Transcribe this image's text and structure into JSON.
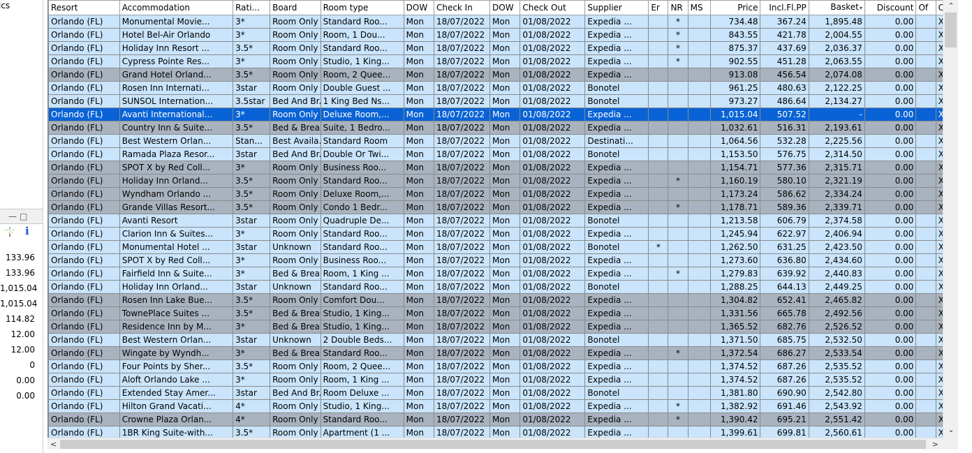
{
  "left_panel": {
    "top_text": "ics",
    "info_symbol": "i",
    "values": [
      "133.96",
      "133.96",
      "1,015.04",
      "1,015.04",
      "114.82",
      "12.00",
      "12.00",
      "0",
      "0.00",
      "0.00"
    ]
  },
  "grid": {
    "columns": [
      "Resort",
      "Accommodation",
      "Rati...",
      "Board",
      "Room type",
      "DOW",
      "Check In",
      "DOW",
      "Check Out",
      "Supplier",
      "Er",
      "NR",
      "MS",
      "Price",
      "Incl.Fl.PP",
      "Basket",
      "Discount",
      "Of",
      "Con"
    ],
    "rows": [
      [
        "Orlando (FL)",
        "Monumental Movie...",
        "3*",
        "Room Only",
        "Standard Roo...",
        "Mon",
        "18/07/2022",
        "Mon",
        "01/08/2022",
        "Expedia ...",
        "",
        "*",
        "",
        "734.48",
        "367.24",
        "1,895.48",
        "0.00",
        "",
        "XMI"
      ],
      [
        "Orlando (FL)",
        "Hotel Bel-Air Orlando",
        "3*",
        "Room Only",
        "Room, 1 Dou...",
        "Mon",
        "18/07/2022",
        "Mon",
        "01/08/2022",
        "Expedia ...",
        "",
        "*",
        "",
        "843.55",
        "421.78",
        "2,004.55",
        "0.00",
        "",
        "XMI"
      ],
      [
        "Orlando (FL)",
        "Holiday Inn Resort ...",
        "3.5*",
        "Room Only",
        "Standard Roo...",
        "Mon",
        "18/07/2022",
        "Mon",
        "01/08/2022",
        "Expedia ...",
        "",
        "*",
        "",
        "875.37",
        "437.69",
        "2,036.37",
        "0.00",
        "",
        "XMI"
      ],
      [
        "Orlando (FL)",
        "Cypress Pointe Res...",
        "3*",
        "Room Only",
        "Studio, 1 King...",
        "Mon",
        "18/07/2022",
        "Mon",
        "01/08/2022",
        "Expedia ...",
        "",
        "*",
        "",
        "902.55",
        "451.28",
        "2,063.55",
        "0.00",
        "",
        "XMI"
      ],
      [
        "Orlando (FL)",
        "Grand Hotel Orland...",
        "3.5*",
        "Room Only",
        "Room, 2 Quee...",
        "Mon",
        "18/07/2022",
        "Mon",
        "01/08/2022",
        "Expedia ...",
        "",
        "",
        "",
        "913.08",
        "456.54",
        "2,074.08",
        "0.00",
        "",
        "XMI"
      ],
      [
        "Orlando (FL)",
        "Rosen Inn Internati...",
        "3star",
        "Room Only",
        "Double Guest ...",
        "Mon",
        "18/07/2022",
        "Mon",
        "01/08/2022",
        "Bonotel",
        "",
        "",
        "",
        "961.25",
        "480.63",
        "2,122.25",
        "0.00",
        "",
        "XMI"
      ],
      [
        "Orlando (FL)",
        "SUNSOL Internation...",
        "3.5star",
        "Bed And Br...",
        "1 King Bed Ns...",
        "Mon",
        "18/07/2022",
        "Mon",
        "01/08/2022",
        "Bonotel",
        "",
        "",
        "",
        "973.27",
        "486.64",
        "2,134.27",
        "0.00",
        "",
        "XMI"
      ],
      [
        "Orlando (FL)",
        "Avanti International...",
        "3*",
        "Room Only",
        "Deluxe Room,...",
        "Mon",
        "18/07/2022",
        "Mon",
        "01/08/2022",
        "Expedia ...",
        "",
        "",
        "",
        "1,015.04",
        "507.52",
        "-",
        "0.00",
        "",
        "XMI"
      ],
      [
        "Orlando (FL)",
        "Country Inn & Suite...",
        "3.5*",
        "Bed & Brea...",
        "Suite, 1 Bedro...",
        "Mon",
        "18/07/2022",
        "Mon",
        "01/08/2022",
        "Expedia ...",
        "",
        "",
        "",
        "1,032.61",
        "516.31",
        "2,193.61",
        "0.00",
        "",
        "XMI"
      ],
      [
        "Orlando (FL)",
        "Best Western Orlan...",
        "Stan...",
        "Best Availa...",
        "Standard Room",
        "Mon",
        "18/07/2022",
        "Mon",
        "01/08/2022",
        "Destinati...",
        "",
        "",
        "",
        "1,064.56",
        "532.28",
        "2,225.56",
        "0.00",
        "",
        "XMI"
      ],
      [
        "Orlando (FL)",
        "Ramada Plaza Resor...",
        "3star",
        "Bed And Br...",
        "Double Or Twi...",
        "Mon",
        "18/07/2022",
        "Mon",
        "01/08/2022",
        "Bonotel",
        "",
        "",
        "",
        "1,153.50",
        "576.75",
        "2,314.50",
        "0.00",
        "",
        "XMI"
      ],
      [
        "Orlando (FL)",
        "SPOT X by Red Coll...",
        "3*",
        "Room Only",
        "Business Roo...",
        "Mon",
        "18/07/2022",
        "Mon",
        "01/08/2022",
        "Expedia ...",
        "",
        "",
        "",
        "1,154.71",
        "577.36",
        "2,315.71",
        "0.00",
        "",
        "XMI"
      ],
      [
        "Orlando (FL)",
        "Holiday Inn Orland...",
        "3.5*",
        "Room Only",
        "Standard Roo...",
        "Mon",
        "18/07/2022",
        "Mon",
        "01/08/2022",
        "Expedia ...",
        "",
        "*",
        "",
        "1,160.19",
        "580.10",
        "2,321.19",
        "0.00",
        "",
        "XMI"
      ],
      [
        "Orlando (FL)",
        "Wyndham Orlando ...",
        "3.5*",
        "Room Only",
        "Deluxe Room,...",
        "Mon",
        "18/07/2022",
        "Mon",
        "01/08/2022",
        "Expedia ...",
        "",
        "",
        "",
        "1,173.24",
        "586.62",
        "2,334.24",
        "0.00",
        "",
        "XMI"
      ],
      [
        "Orlando (FL)",
        "Grande Villas Resort...",
        "3.5*",
        "Room Only",
        "Condo 1 Bedr...",
        "Mon",
        "18/07/2022",
        "Mon",
        "01/08/2022",
        "Expedia ...",
        "",
        "*",
        "",
        "1,178.71",
        "589.36",
        "2,339.71",
        "0.00",
        "",
        "XMI"
      ],
      [
        "Orlando (FL)",
        "Avanti Resort",
        "3star",
        "Room Only",
        "Quadruple De...",
        "Mon",
        "18/07/2022",
        "Mon",
        "01/08/2022",
        "Bonotel",
        "",
        "",
        "",
        "1,213.58",
        "606.79",
        "2,374.58",
        "0.00",
        "",
        "XMI"
      ],
      [
        "Orlando (FL)",
        "Clarion Inn & Suites...",
        "3*",
        "Room Only",
        "Standard Roo...",
        "Mon",
        "18/07/2022",
        "Mon",
        "01/08/2022",
        "Expedia ...",
        "",
        "",
        "",
        "1,245.94",
        "622.97",
        "2,406.94",
        "0.00",
        "",
        "XMI"
      ],
      [
        "Orlando (FL)",
        "Monumental Hotel ...",
        "3star",
        "Unknown",
        "Standard Roo...",
        "Mon",
        "18/07/2022",
        "Mon",
        "01/08/2022",
        "Bonotel",
        "*",
        "",
        "",
        "1,262.50",
        "631.25",
        "2,423.50",
        "0.00",
        "",
        "XMI"
      ],
      [
        "Orlando (FL)",
        "SPOT X by Red Coll...",
        "3*",
        "Room Only",
        "Business Roo...",
        "Mon",
        "18/07/2022",
        "Mon",
        "01/08/2022",
        "Expedia ...",
        "",
        "",
        "",
        "1,273.60",
        "636.80",
        "2,434.60",
        "0.00",
        "",
        "XMI"
      ],
      [
        "Orlando (FL)",
        "Fairfield Inn & Suite...",
        "3*",
        "Bed & Brea...",
        "Room, 1 King ...",
        "Mon",
        "18/07/2022",
        "Mon",
        "01/08/2022",
        "Expedia ...",
        "",
        "*",
        "",
        "1,279.83",
        "639.92",
        "2,440.83",
        "0.00",
        "",
        "XMI"
      ],
      [
        "Orlando (FL)",
        "Holiday Inn Orland...",
        "3star",
        "Unknown",
        "Standard Roo...",
        "Mon",
        "18/07/2022",
        "Mon",
        "01/08/2022",
        "Bonotel",
        "",
        "",
        "",
        "1,288.25",
        "644.13",
        "2,449.25",
        "0.00",
        "",
        "XMI"
      ],
      [
        "Orlando (FL)",
        "Rosen Inn Lake Bue...",
        "3.5*",
        "Room Only",
        "Comfort Dou...",
        "Mon",
        "18/07/2022",
        "Mon",
        "01/08/2022",
        "Expedia ...",
        "",
        "",
        "",
        "1,304.82",
        "652.41",
        "2,465.82",
        "0.00",
        "",
        "XMI"
      ],
      [
        "Orlando (FL)",
        "TownePlace Suites ...",
        "3.5*",
        "Bed & Brea...",
        "Studio, 1 King...",
        "Mon",
        "18/07/2022",
        "Mon",
        "01/08/2022",
        "Expedia ...",
        "",
        "",
        "",
        "1,331.56",
        "665.78",
        "2,492.56",
        "0.00",
        "",
        "XMI"
      ],
      [
        "Orlando (FL)",
        "Residence Inn by M...",
        "3*",
        "Bed & Brea...",
        "Studio, 1 King...",
        "Mon",
        "18/07/2022",
        "Mon",
        "01/08/2022",
        "Expedia ...",
        "",
        "",
        "",
        "1,365.52",
        "682.76",
        "2,526.52",
        "0.00",
        "",
        "XMI"
      ],
      [
        "Orlando (FL)",
        "Best Western Orlan...",
        "3star",
        "Unknown",
        "2 Double Beds...",
        "Mon",
        "18/07/2022",
        "Mon",
        "01/08/2022",
        "Bonotel",
        "",
        "",
        "",
        "1,371.50",
        "685.75",
        "2,532.50",
        "0.00",
        "",
        "XMI"
      ],
      [
        "Orlando (FL)",
        "Wingate by Wyndh...",
        "3*",
        "Bed & Brea...",
        "Standard Roo...",
        "Mon",
        "18/07/2022",
        "Mon",
        "01/08/2022",
        "Expedia ...",
        "",
        "*",
        "",
        "1,372.54",
        "686.27",
        "2,533.54",
        "0.00",
        "",
        "XMI"
      ],
      [
        "Orlando (FL)",
        "Four Points by Sher...",
        "3.5*",
        "Room Only",
        "Room, 2 Quee...",
        "Mon",
        "18/07/2022",
        "Mon",
        "01/08/2022",
        "Expedia ...",
        "",
        "",
        "",
        "1,374.52",
        "687.26",
        "2,535.52",
        "0.00",
        "",
        "XMI"
      ],
      [
        "Orlando (FL)",
        "Aloft Orlando Lake ...",
        "3*",
        "Room Only",
        "Room, 1 King ...",
        "Mon",
        "18/07/2022",
        "Mon",
        "01/08/2022",
        "Expedia ...",
        "",
        "",
        "",
        "1,374.52",
        "687.26",
        "2,535.52",
        "0.00",
        "",
        "XMI"
      ],
      [
        "Orlando (FL)",
        "Extended Stay Amer...",
        "3star",
        "Bed And Br...",
        "Room Deluxe ...",
        "Mon",
        "18/07/2022",
        "Mon",
        "01/08/2022",
        "Bonotel",
        "",
        "",
        "",
        "1,381.80",
        "690.90",
        "2,542.80",
        "0.00",
        "",
        "XMI"
      ],
      [
        "Orlando (FL)",
        "Hilton Grand Vacati...",
        "4*",
        "Room Only",
        "Studio, 1 King...",
        "Mon",
        "18/07/2022",
        "Mon",
        "01/08/2022",
        "Expedia ...",
        "",
        "*",
        "",
        "1,382.92",
        "691.46",
        "2,543.92",
        "0.00",
        "",
        "XMI"
      ],
      [
        "Orlando (FL)",
        "Crowne Plaza Orlan...",
        "4*",
        "Room Only",
        "Standard Roo...",
        "Mon",
        "18/07/2022",
        "Mon",
        "01/08/2022",
        "Expedia ...",
        "",
        "*",
        "",
        "1,390.42",
        "695.21",
        "2,551.42",
        "0.00",
        "",
        "XMI"
      ],
      [
        "Orlando (FL)",
        "1BR King Suite-with...",
        "3.5*",
        "Room Only",
        "Apartment (1 ...",
        "Mon",
        "18/07/2022",
        "Mon",
        "01/08/2022",
        "Expedia ...",
        "",
        "",
        "",
        "1,399.61",
        "699.81",
        "2,560.61",
        "0.00",
        "",
        "XMI"
      ]
    ],
    "row_styles": [
      "a",
      "a",
      "a",
      "a",
      "b",
      "a",
      "a",
      "sel",
      "b",
      "a",
      "a",
      "b",
      "b",
      "b",
      "b",
      "a",
      "a",
      "a",
      "a",
      "a",
      "a",
      "b",
      "b",
      "b",
      "a",
      "b",
      "a",
      "a",
      "a",
      "a",
      "b",
      "a"
    ],
    "selected_row_index": 7,
    "sorted_column": "Basket"
  },
  "colors": {
    "row_light": "#c9e4fb",
    "row_gray": "#a9b3bf",
    "row_selected": "#0a63d6",
    "info_icon": "#1b4ed8"
  },
  "icons": [
    "restore-icon",
    "maximize-icon",
    "palm-tree-icon",
    "info-icon",
    "scroll-up-icon",
    "scroll-down-icon",
    "scroll-left-icon",
    "scroll-right-icon",
    "sort-desc-icon"
  ]
}
